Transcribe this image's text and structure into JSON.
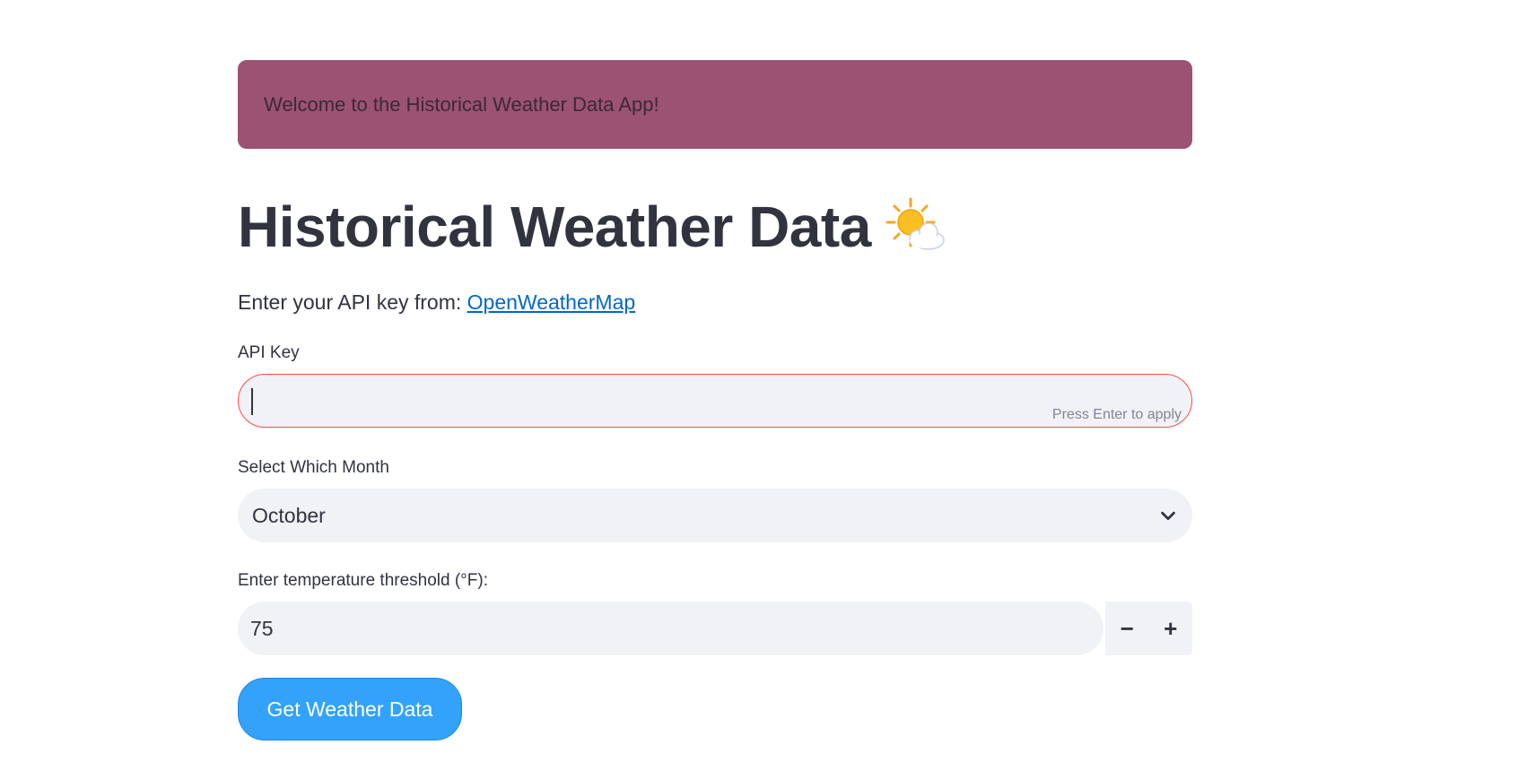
{
  "banner": {
    "message": "Welcome to the Historical Weather Data App!",
    "color": "#9c5273"
  },
  "header": {
    "title": "Historical Weather Data",
    "icon": "sun-behind-cloud-icon"
  },
  "intro": {
    "text": "Enter your API key from: ",
    "link_text": "OpenWeatherMap"
  },
  "api_key": {
    "label": "API Key",
    "value": "",
    "hint": "Press Enter to apply",
    "border_color": "#ff4b4b"
  },
  "month": {
    "label": "Select Which Month",
    "selected": "October"
  },
  "threshold": {
    "label": "Enter temperature threshold (°F):",
    "value": "75",
    "decrement": "−",
    "increment": "+"
  },
  "submit": {
    "label": "Get Weather Data",
    "color": "#33a2fb"
  }
}
